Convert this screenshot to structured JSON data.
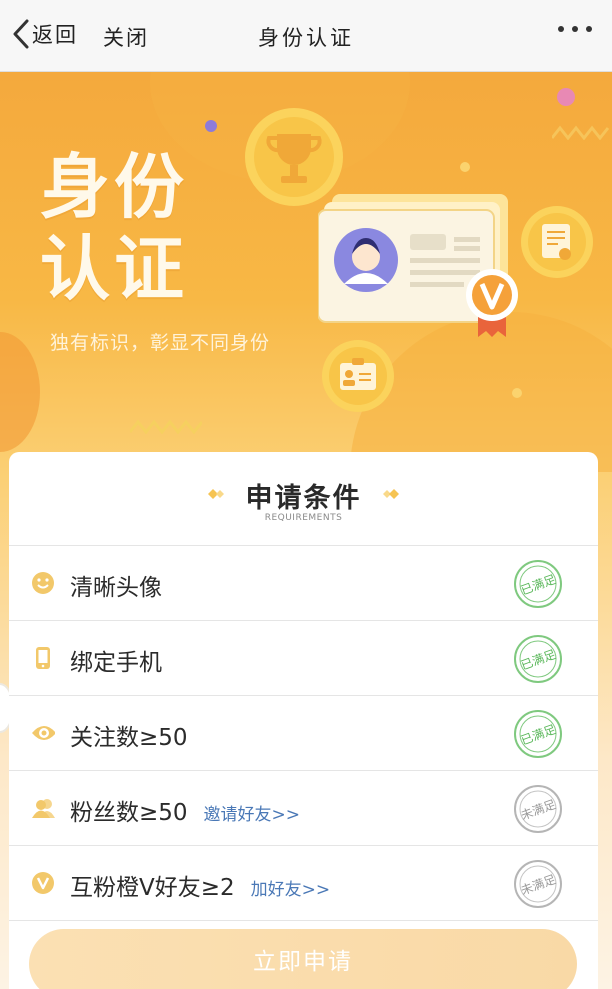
{
  "navbar": {
    "back_label": "返回",
    "close_label": "关闭",
    "title": "身份认证"
  },
  "banner": {
    "title_line1": "身份",
    "title_line2": "认证",
    "subtitle": "独有标识，彰显不同身份"
  },
  "requirements": {
    "title": "申请条件",
    "subtitle": "REQUIREMENTS",
    "items": [
      {
        "icon": "smile-icon",
        "label": "清晰头像",
        "link": "",
        "status": "已满足",
        "status_color": "#5cb85c"
      },
      {
        "icon": "phone-icon",
        "label": "绑定手机",
        "link": "",
        "status": "已满足",
        "status_color": "#5cb85c"
      },
      {
        "icon": "eye-icon",
        "label": "关注数≥50",
        "link": "",
        "status": "已满足",
        "status_color": "#5cb85c"
      },
      {
        "icon": "users-icon",
        "label": "粉丝数≥50",
        "link": "邀请好友>>",
        "status": "未满足",
        "status_color": "#9a9a9a"
      },
      {
        "icon": "v-badge-icon",
        "label": "互粉橙V好友≥2",
        "link": "加好友>>",
        "status": "未满足",
        "status_color": "#9a9a9a"
      }
    ]
  },
  "apply_button": {
    "label": "立即申请"
  },
  "colors": {
    "accent": "#f5a83a",
    "icon_color": "#f2c86a",
    "link": "#4a78b6"
  }
}
